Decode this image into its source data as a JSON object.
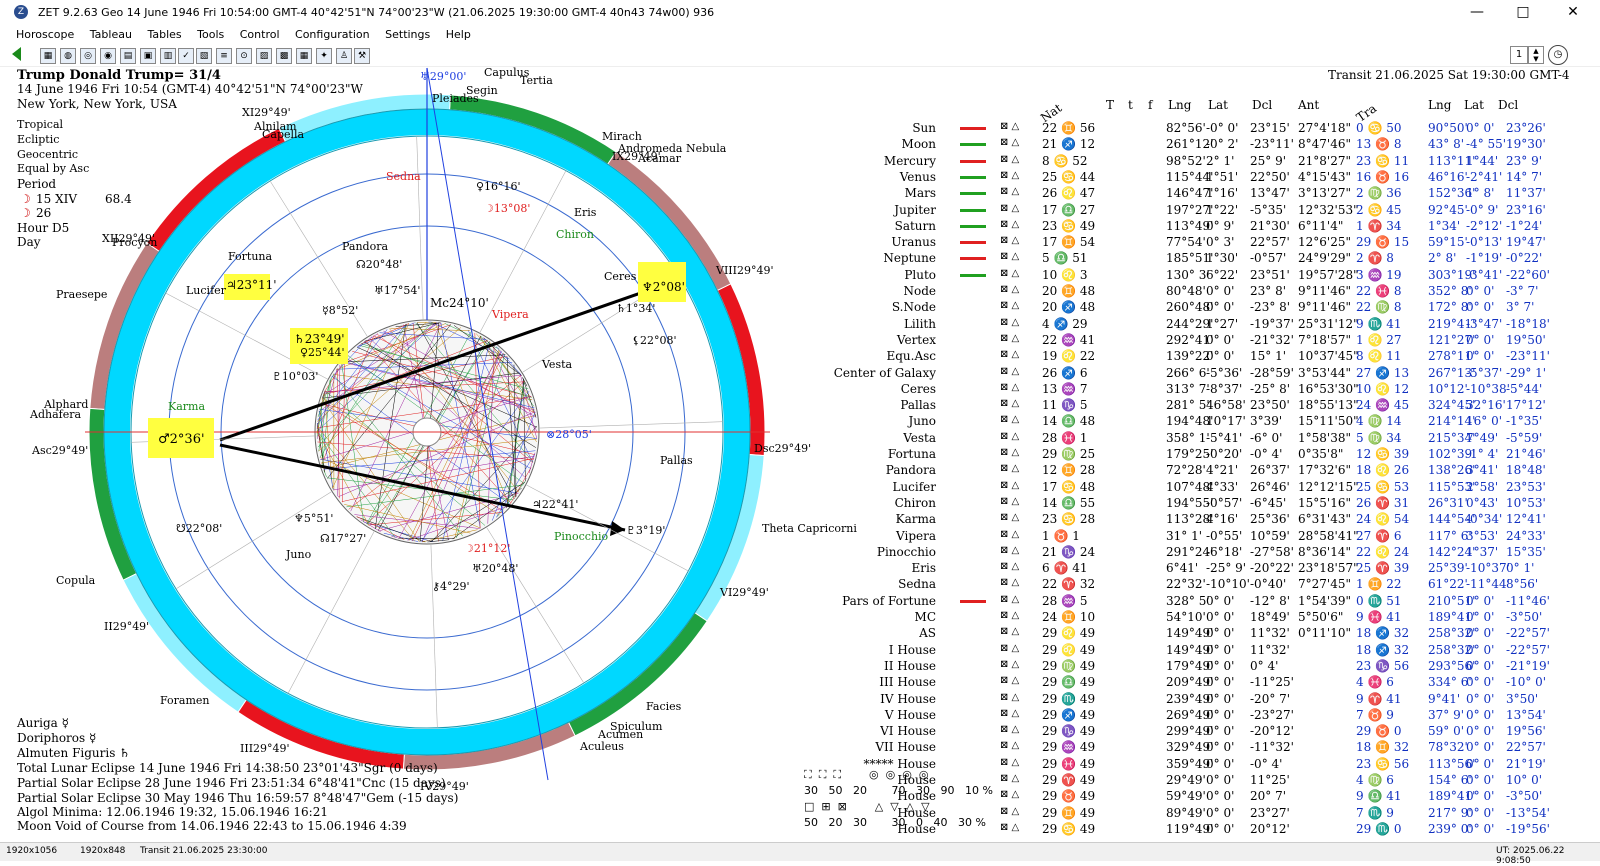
{
  "window": {
    "title": "ZET 9.2.63 Geo    14 June 1946  Fri  10:54:00 GMT-4 40°42'51\"N  74°00'23\"W  (21.06.2025  19:30:00 GMT-4 40n43 74w00)   936",
    "minimize": "—",
    "maximize": "□",
    "close": "✕"
  },
  "menu": [
    "Horoscope",
    "Tableau",
    "Tables",
    "Tools",
    "Control",
    "Configuration",
    "Settings",
    "Help"
  ],
  "toolbar": {
    "page_number": "1"
  },
  "chart_header": {
    "name": "Trump Donald Trump= 31/4",
    "date_line": "14 June 1946  Fri  10:54 (GMT-4) 40°42'51\"N  74°00'23\"W",
    "place": "New York, New York, USA",
    "options": [
      "Tropical",
      "Ecliptic",
      "Geocentric",
      "Equal by Asc"
    ],
    "period_label": "Period",
    "period_lines": [
      "15 XIV",
      "26"
    ],
    "period_extra": "68.4",
    "hour_label": "Hour D5",
    "day_label": "Day"
  },
  "transit_header": "Transit 21.06.2025  Sat 19:30:00 GMT-4",
  "table_headers": {
    "nat": "Nat",
    "T": "T",
    "t": "t",
    "f": "f",
    "lng": "Lng",
    "lat": "Lat",
    "dcl": "Dcl",
    "ant": "Ant",
    "tra": "Tra",
    "tlng": "Lng",
    "tlat": "Lat",
    "tdcl": "Dcl"
  },
  "rows": [
    {
      "name": "Sun",
      "nat": "22 ♊ 56",
      "lng": "82°56'",
      "lat": "-0° 0'",
      "dcl": "23°15'",
      "ant": "27°4'18\"",
      "tra": "0 ♋ 50",
      "tlng": "90°50'",
      "tlat": "0° 0'",
      "tdcl": "23°26'",
      "bar": "#e02020"
    },
    {
      "name": "Moon",
      "nat": "21 ♐ 12",
      "lng": "261°12'",
      "lat": "-0° 2'",
      "dcl": "-23°11'",
      "ant": "8°47'46\"",
      "tra": "13 ♉ 8",
      "tlng": "43° 8'",
      "tlat": "-4° 55'",
      "tdcl": "19°30'",
      "bar": "#20a020"
    },
    {
      "name": "Mercury",
      "nat": "8 ♋ 52",
      "lng": "98°52'",
      "lat": "2° 1'",
      "dcl": "25° 9'",
      "ant": "21°8'27\"",
      "tra": "23 ♋ 11",
      "tlng": "113°11'",
      "tlat": "1°44'",
      "tdcl": "23° 9'",
      "bar": "#e02020"
    },
    {
      "name": "Venus",
      "nat": "25 ♋ 44",
      "lng": "115°44'",
      "lat": "1°51'",
      "dcl": "22°50'",
      "ant": "4°15'43\"",
      "tra": "16 ♉ 16",
      "tlng": "46°16'",
      "tlat": "-2°41'",
      "tdcl": "14° 7'",
      "bar": "#20a020"
    },
    {
      "name": "Mars",
      "nat": "26 ♌ 47",
      "lng": "146°47'",
      "lat": "1°16'",
      "dcl": "13°47'",
      "ant": "3°13'27\"",
      "tra": "2 ♍ 36",
      "tlng": "152°36'",
      "tlat": "1° 8'",
      "tdcl": "11°37'",
      "bar": "#20a020"
    },
    {
      "name": "Jupiter",
      "nat": "17 ♎ 27",
      "lng": "197°27'",
      "lat": "1°22'",
      "dcl": "-5°35'",
      "ant": "12°32'53\"",
      "tra": "2 ♋ 45",
      "tlng": "92°45'",
      "tlat": "-0° 9'",
      "tdcl": "23°16'",
      "bar": "#20a020"
    },
    {
      "name": "Saturn",
      "nat": "23 ♋ 49",
      "lng": "113°49'",
      "lat": "0° 9'",
      "dcl": "21°30'",
      "ant": "6°11'4\"",
      "tra": "1 ♈ 34",
      "tlng": "1°34'",
      "tlat": "-2°12'",
      "tdcl": "-1°24'",
      "bar": "#20a020"
    },
    {
      "name": "Uranus",
      "nat": "17 ♊ 54",
      "lng": "77°54'",
      "lat": "0° 3'",
      "dcl": "22°57'",
      "ant": "12°6'25\"",
      "tra": "29 ♉ 15",
      "tlng": "59°15'",
      "tlat": "-0°13'",
      "tdcl": "19°47'",
      "bar": "#e02020"
    },
    {
      "name": "Neptune",
      "nat": "5 ♎ 51",
      "lng": "185°51'",
      "lat": "1°30'",
      "dcl": "-0°57'",
      "ant": "24°9'29\"",
      "tra": "2 ♈ 8",
      "tlng": "2° 8'",
      "tlat": "-1°19'",
      "tdcl": "-0°22'",
      "bar": "#e02020"
    },
    {
      "name": "Pluto",
      "nat": "10 ♌ 3",
      "lng": "130° 3'",
      "lat": "6°22'",
      "dcl": "23°51'",
      "ant": "19°57'28\"",
      "tra": "3 ♒ 19",
      "tlng": "303°19'",
      "tlat": "-3°41'",
      "tdcl": "-22°60'",
      "bar": "#20a020"
    },
    {
      "name": "Node",
      "nat": "20 ♊ 48",
      "lng": "80°48'",
      "lat": "0° 0'",
      "dcl": "23° 8'",
      "ant": "9°11'46\"",
      "tra": "22 ♓ 8",
      "tlng": "352° 8'",
      "tlat": "0° 0'",
      "tdcl": "-3° 7'",
      "bar": ""
    },
    {
      "name": "S.Node",
      "nat": "20 ♐ 48",
      "lng": "260°48'",
      "lat": "0° 0'",
      "dcl": "-23° 8'",
      "ant": "9°11'46\"",
      "tra": "22 ♍ 8",
      "tlng": "172° 8'",
      "tlat": "0° 0'",
      "tdcl": "3° 7'",
      "bar": ""
    },
    {
      "name": "Lilith",
      "nat": "4 ♐ 29",
      "lng": "244°29'",
      "lat": "1°27'",
      "dcl": "-19°37'",
      "ant": "25°31'12\"",
      "tra": "9 ♏ 41",
      "tlng": "219°41'",
      "tlat": "-3°47'",
      "tdcl": "-18°18'",
      "bar": ""
    },
    {
      "name": "Vertex",
      "nat": "22 ♒ 41",
      "lng": "292°41'",
      "lat": "0° 0'",
      "dcl": "-21°32'",
      "ant": "7°18'57\"",
      "tra": "1 ♌ 27",
      "tlng": "121°27'",
      "tlat": "0° 0'",
      "tdcl": "19°50'",
      "bar": ""
    },
    {
      "name": "Equ.Asc",
      "nat": "19 ♌ 22",
      "lng": "139°22'",
      "lat": "0° 0'",
      "dcl": "15° 1'",
      "ant": "10°37'45\"",
      "tra": "8 ♌ 11",
      "tlng": "278°11'",
      "tlat": "0° 0'",
      "tdcl": "-23°11'",
      "bar": ""
    },
    {
      "name": "Center of Galaxy",
      "nat": "26 ♐ 6",
      "lng": "266° 6'",
      "lat": "-5°36'",
      "dcl": "-28°59'",
      "ant": "3°53'44\"",
      "tra": "27 ♐ 13",
      "tlng": "267°13'",
      "tlat": "-5°37'",
      "tdcl": "-29° 1'",
      "bar": ""
    },
    {
      "name": "Ceres",
      "nat": "13 ♒ 7",
      "lng": "313° 7'",
      "lat": "-8°37'",
      "dcl": "-25° 8'",
      "ant": "16°53'30\"",
      "tra": "10 ♌ 12",
      "tlng": "10°12'",
      "tlat": "-10°38'",
      "tdcl": "-5°44'",
      "bar": ""
    },
    {
      "name": "Pallas",
      "nat": "11 ♑ 5",
      "lng": "281° 5'",
      "lat": "46°58'",
      "dcl": "23°50'",
      "ant": "18°55'13\"",
      "tra": "24 ♒ 45",
      "tlng": "324°45'",
      "tlat": "32°16'",
      "tdcl": "17°12'",
      "bar": ""
    },
    {
      "name": "Juno",
      "nat": "14 ♎ 48",
      "lng": "194°48'",
      "lat": "10°17'",
      "dcl": "3°39'",
      "ant": "15°11'50\"",
      "tra": "4 ♍ 14",
      "tlng": "214°14'",
      "tlat": "16° 0'",
      "tdcl": "-1°35'",
      "bar": ""
    },
    {
      "name": "Vesta",
      "nat": "28 ♓ 1",
      "lng": "358° 1'",
      "lat": "-5°41'",
      "dcl": "-6° 0'",
      "ant": "1°58'38\"",
      "tra": "5 ♍ 34",
      "tlng": "215°34'",
      "tlat": "7°49'",
      "tdcl": "-5°59'",
      "bar": ""
    },
    {
      "name": "Fortuna",
      "nat": "29 ♍ 25",
      "lng": "179°25'",
      "lat": "-0°20'",
      "dcl": "-0° 4'",
      "ant": "0°35'8\"",
      "tra": "12 ♋ 39",
      "tlng": "102°39'",
      "tlat": "-1° 4'",
      "tdcl": "21°46'",
      "bar": ""
    },
    {
      "name": "Pandora",
      "nat": "12 ♊ 28",
      "lng": "72°28'",
      "lat": "4°21'",
      "dcl": "26°37'",
      "ant": "17°32'6\"",
      "tra": "18 ♌ 26",
      "tlng": "138°26'",
      "tlat": "3°41'",
      "tdcl": "18°48'",
      "bar": ""
    },
    {
      "name": "Lucifer",
      "nat": "17 ♋ 48",
      "lng": "107°48'",
      "lat": "4°33'",
      "dcl": "26°46'",
      "ant": "12°12'15\"",
      "tra": "25 ♋ 53",
      "tlng": "115°53'",
      "tlat": "2°58'",
      "tdcl": "23°53'",
      "bar": ""
    },
    {
      "name": "Chiron",
      "nat": "14 ♎ 55",
      "lng": "194°55'",
      "lat": "-0°57'",
      "dcl": "-6°45'",
      "ant": "15°5'16\"",
      "tra": "26 ♈ 31",
      "tlng": "26°31'",
      "tlat": "0°43'",
      "tdcl": "10°53'",
      "bar": ""
    },
    {
      "name": "Karma",
      "nat": "23 ♋ 28",
      "lng": "113°28'",
      "lat": "4°16'",
      "dcl": "25°36'",
      "ant": "6°31'43\"",
      "tra": "24 ♌ 54",
      "tlng": "144°54'",
      "tlat": "-0°34'",
      "tdcl": "12°41'",
      "bar": ""
    },
    {
      "name": "Vipera",
      "nat": "1 ♉ 1",
      "lng": "31° 1'",
      "lat": "-0°55'",
      "dcl": "10°59'",
      "ant": "28°58'41\"",
      "tra": "27 ♈ 6",
      "tlng": "117° 6'",
      "tlat": "3°53'",
      "tdcl": "24°33'",
      "bar": ""
    },
    {
      "name": "Pinocchio",
      "nat": "21 ♑ 24",
      "lng": "291°24'",
      "lat": "-6°18'",
      "dcl": "-27°58'",
      "ant": "8°36'14\"",
      "tra": "22 ♌ 24",
      "tlng": "142°24'",
      "tlat": "1°37'",
      "tdcl": "15°35'",
      "bar": ""
    },
    {
      "name": "Eris",
      "nat": "6 ♈ 41",
      "lng": "6°41'",
      "lat": "-25° 9'",
      "dcl": "-20°22'",
      "ant": "23°18'57\"",
      "tra": "25 ♈ 39",
      "tlng": "25°39'",
      "tlat": "-10°37'",
      "tdcl": "0° 1'",
      "bar": ""
    },
    {
      "name": "Sedna",
      "nat": "22 ♈ 32",
      "lng": "22°32'",
      "lat": "-10°10'",
      "dcl": "-0°40'",
      "ant": "7°27'45\"",
      "tra": "1 ♊ 22",
      "tlng": "61°22'",
      "tlat": "-11°44'",
      "tdcl": "8°56'",
      "bar": ""
    },
    {
      "name": "Pars of Fortune",
      "nat": "28 ♒ 5",
      "lng": "328° 5'",
      "lat": "0° 0'",
      "dcl": "-12° 8'",
      "ant": "1°54'39\"",
      "tra": "0 ♏ 51",
      "tlng": "210°51'",
      "tlat": "0° 0'",
      "tdcl": "-11°46'",
      "bar": "#e02020"
    },
    {
      "name": "MC",
      "nat": "24 ♊ 10",
      "lng": "54°10'",
      "lat": "0° 0'",
      "dcl": "18°49'",
      "ant": "5°50'6\"",
      "tra": "9 ♓ 41",
      "tlng": "189°41'",
      "tlat": "0° 0'",
      "tdcl": "-3°50'",
      "bar": ""
    },
    {
      "name": "AS",
      "nat": "29 ♌ 49",
      "lng": "149°49'",
      "lat": "0° 0'",
      "dcl": "11°32'",
      "ant": "0°11'10\"",
      "tra": "18 ♐ 32",
      "tlng": "258°32'",
      "tlat": "0° 0'",
      "tdcl": "-22°57'",
      "bar": ""
    },
    {
      "name": "I House",
      "nat": "29 ♌ 49",
      "lng": "149°49'",
      "lat": "0° 0'",
      "dcl": "11°32'",
      "ant": "",
      "tra": "18 ♐ 32",
      "tlng": "258°32'",
      "tlat": "0° 0'",
      "tdcl": "-22°57'",
      "bar": ""
    },
    {
      "name": "II House",
      "nat": "29 ♍ 49",
      "lng": "179°49'",
      "lat": "0° 0'",
      "dcl": "0° 4'",
      "ant": "",
      "tra": "23 ♑ 56",
      "tlng": "293°56'",
      "tlat": "0° 0'",
      "tdcl": "-21°19'",
      "bar": ""
    },
    {
      "name": "III House",
      "nat": "29 ♎ 49",
      "lng": "209°49'",
      "lat": "0° 0'",
      "dcl": "-11°25'",
      "ant": "",
      "tra": "4 ♓ 6",
      "tlng": "334° 6'",
      "tlat": "0° 0'",
      "tdcl": "-10° 0'",
      "bar": ""
    },
    {
      "name": "IV House",
      "nat": "29 ♏ 49",
      "lng": "239°49'",
      "lat": "0° 0'",
      "dcl": "-20° 7'",
      "ant": "",
      "tra": "9 ♈ 41",
      "tlng": "9°41'",
      "tlat": "0° 0'",
      "tdcl": "3°50'",
      "bar": ""
    },
    {
      "name": "V House",
      "nat": "29 ♐ 49",
      "lng": "269°49'",
      "lat": "0° 0'",
      "dcl": "-23°27'",
      "ant": "",
      "tra": "7 ♉ 9",
      "tlng": "37° 9'",
      "tlat": "0° 0'",
      "tdcl": "13°54'",
      "bar": ""
    },
    {
      "name": "VI House",
      "nat": "29 ♑ 49",
      "lng": "299°49'",
      "lat": "0° 0'",
      "dcl": "-20°12'",
      "ant": "",
      "tra": "29 ♉ 0",
      "tlng": "59° 0'",
      "tlat": "0° 0'",
      "tdcl": "19°56'",
      "bar": ""
    },
    {
      "name": "VII House",
      "nat": "29 ♒ 49",
      "lng": "329°49'",
      "lat": "0° 0'",
      "dcl": "-11°32'",
      "ant": "",
      "tra": "18 ♊ 32",
      "tlng": "78°32'",
      "tlat": "0° 0'",
      "tdcl": "22°57'",
      "bar": ""
    },
    {
      "name": "***** House",
      "nat": "29 ♓ 49",
      "lng": "359°49'",
      "lat": "0° 0'",
      "dcl": "-0° 4'",
      "ant": "",
      "tra": "23 ♋ 56",
      "tlng": "113°56'",
      "tlat": "0° 0'",
      "tdcl": "21°19'",
      "bar": ""
    },
    {
      "name": "House",
      "nat": "29 ♈ 49",
      "lng": "29°49'",
      "lat": "0° 0'",
      "dcl": "11°25'",
      "ant": "",
      "tra": "4 ♍ 6",
      "tlng": "154° 6'",
      "tlat": "0° 0'",
      "tdcl": "10° 0'",
      "bar": ""
    },
    {
      "name": "House",
      "nat": "29 ♉ 49",
      "lng": "59°49'",
      "lat": "0° 0'",
      "dcl": "20° 7'",
      "ant": "",
      "tra": "9 ♎ 41",
      "tlng": "189°41'",
      "tlat": "0° 0'",
      "tdcl": "-3°50'",
      "bar": ""
    },
    {
      "name": "House",
      "nat": "29 ♊ 49",
      "lng": "89°49'",
      "lat": "0° 0'",
      "dcl": "23°27'",
      "ant": "",
      "tra": "7 ♏ 9",
      "tlng": "217° 9'",
      "tlat": "0° 0'",
      "tdcl": "-13°54'",
      "bar": ""
    },
    {
      "name": "House",
      "nat": "29 ♋ 49",
      "lng": "119°49'",
      "lat": "0° 0'",
      "dcl": "20°12'",
      "ant": "",
      "tra": "29 ♏ 0",
      "tlng": "239° 0'",
      "tlat": "0° 0'",
      "tdcl": "-19°56'",
      "bar": ""
    }
  ],
  "bottom_left": [
    "Auriga  ☿",
    "Doriphoros  ☿",
    "Almuten Figuris  ♄",
    "Total Lunar Eclipse 14 June 1946 Fri 14:38:50 23°01'43\"Sgr (0 days)",
    "Partial Solar Eclipse 28 June 1946 Fri 23:51:34  6°48'41\"Cnc (15 days)",
    "Partial Solar Eclipse 30 May 1946 Thu 16:59:57  8°48'47\"Gem (-15 days)",
    "Algol Minima: 12.06.1946 19:32,  15.06.1946 16:21",
    "Moon Void of Course from 14.06.1946 22:43 to 15.06.1946  4:39"
  ],
  "orb_grid": {
    "row1": [
      "30",
      "50",
      "20",
      "70",
      "30",
      "90",
      "10 %"
    ],
    "row2": [
      "50",
      "20",
      "30",
      "30",
      "0",
      "40",
      "30 %"
    ]
  },
  "wheel": {
    "house_labels": [
      {
        "text": "IX29°49'"
      },
      {
        "text": "VIII29°49'"
      },
      {
        "text": "XII29°49'"
      },
      {
        "text": "XI29°49'"
      },
      {
        "text": "II29°49'"
      },
      {
        "text": "III29°49'"
      },
      {
        "text": "IV29°49'"
      },
      {
        "text": "VI29°49'"
      },
      {
        "text": "Dsc29°49'"
      },
      {
        "text": "Asc29°49'"
      }
    ],
    "natal_points": [
      {
        "label": "♂2°36'"
      },
      {
        "label": "♃23°11'"
      },
      {
        "label": "♄23°49'"
      },
      {
        "label": "♀25°44'"
      },
      {
        "label": "♇10°03'"
      },
      {
        "label": "☿8°52'"
      },
      {
        "label": "♅17°54'"
      },
      {
        "label": "☊20°48'"
      },
      {
        "label": "Mc24°10'"
      },
      {
        "label": "♀16°16'"
      },
      {
        "label": "☽13°08'"
      },
      {
        "label": "♆5°51'"
      },
      {
        "label": "☊17°27'"
      },
      {
        "label": "☽21°12'"
      },
      {
        "label": "♅20°48'"
      },
      {
        "label": "⚷4°29'"
      },
      {
        "label": "⊗28°05'"
      },
      {
        "label": "♃22°41'"
      }
    ],
    "transit_points": [
      {
        "label": "♆2°08'"
      },
      {
        "label": "♄1°34'"
      },
      {
        "label": "♇3°19'"
      },
      {
        "label": "⚸22°08'"
      },
      {
        "label": "☋22°08'"
      },
      {
        "label": "♅29°00'"
      }
    ],
    "star_labels": [
      "Capulus",
      "Tertia",
      "Segin",
      "Pleiades",
      "Mirach",
      "Andromeda Nebula",
      "Acamar",
      "Capella",
      "Alnilam",
      "Procyon",
      "Praesepe",
      "Alphard",
      "Adhafera",
      "Copula",
      "Foramen",
      "Theta Capricorni",
      "Facies",
      "Spiculum",
      "Aculeus",
      "Acumen",
      "Sedna",
      "Eris",
      "Chiron",
      "Ceres",
      "Pandora",
      "Fortuna",
      "Lucifer",
      "Vipera",
      "Vesta",
      "Pallas",
      "Pinocchio",
      "Juno",
      "Karma"
    ]
  },
  "status_bar": {
    "left": "1920x1056",
    "mid": "1920x848",
    "transit": "Transit   21.06.2025 23:30:00",
    "right": "UT: 2025.06.22 9:08:50"
  }
}
